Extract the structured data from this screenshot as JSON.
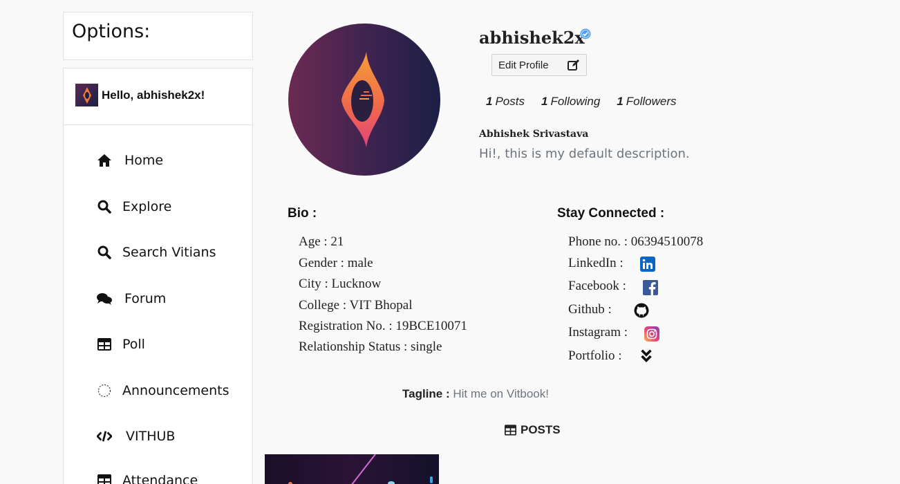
{
  "sidebar": {
    "options_title": "Options:",
    "greeting": "Hello, abhishek2x!",
    "items": [
      {
        "label": "Home",
        "icon": "home-icon"
      },
      {
        "label": "Explore",
        "icon": "search-icon"
      },
      {
        "label": "Search Vitians",
        "icon": "search-icon"
      },
      {
        "label": "Forum",
        "icon": "comments-icon"
      },
      {
        "label": "Poll",
        "icon": "table-icon"
      },
      {
        "label": "Announcements",
        "icon": "dotted-circle-icon"
      },
      {
        "label": "VITHUB",
        "icon": "code-icon"
      },
      {
        "label": "Attendance",
        "icon": "table-icon"
      }
    ]
  },
  "profile": {
    "username": "abhishek2x",
    "edit_label": "Edit Profile",
    "stats": [
      {
        "count": "1",
        "label": "Posts"
      },
      {
        "count": "1",
        "label": "Following"
      },
      {
        "count": "1",
        "label": "Followers"
      }
    ],
    "full_name": "Abhishek Srivastava",
    "description": "Hi!, this is my default description."
  },
  "bio": {
    "title": "Bio :",
    "lines": [
      "Age : 21",
      "Gender : male",
      "City : Lucknow",
      "College : VIT Bhopal",
      "Registration No. : 19BCE10071",
      "Relationship Status : single"
    ]
  },
  "connected": {
    "title": "Stay Connected :",
    "phone": "Phone no. : 06394510078",
    "links": [
      {
        "label": "LinkedIn :",
        "icon": "linkedin-icon"
      },
      {
        "label": "Facebook :",
        "icon": "facebook-icon"
      },
      {
        "label": "Github :",
        "icon": "github-icon"
      },
      {
        "label": "Instagram :",
        "icon": "instagram-icon"
      },
      {
        "label": "Portfolio :",
        "icon": "chevrons-down-icon"
      }
    ]
  },
  "tagline": {
    "label": "Tagline :",
    "value": "Hit me on Vitbook!"
  },
  "posts": {
    "heading": "POSTS"
  },
  "colors": {
    "verified": "#4a9ff5",
    "linkedin": "#0a66c2",
    "facebook": "#3b5998",
    "muted": "#6c757d"
  }
}
